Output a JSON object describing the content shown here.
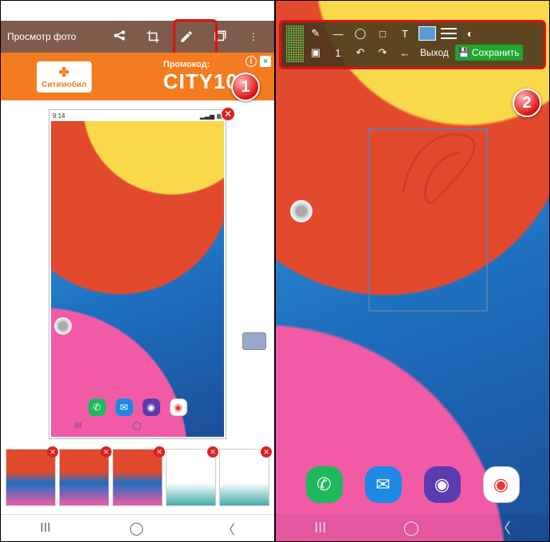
{
  "panel1": {
    "title": "Просмотр фото",
    "ad": {
      "brand": "Ситимобил",
      "promo_label": "Промокод:",
      "code": "CITY10"
    },
    "statusbar_time": "9:14",
    "nav": {
      "recents": "III",
      "home": "◯",
      "back": "〈"
    },
    "step_badge": "1"
  },
  "panel2": {
    "toolbar": {
      "row1_icons": [
        "pencil",
        "line",
        "circle",
        "square",
        "text",
        "color",
        "lines",
        "eyedropper"
      ],
      "row2_icons": [
        "crop",
        "undo",
        "redo",
        "back"
      ],
      "exit_label": "Выход",
      "save_label": "Сохранить"
    },
    "nav": {
      "recents": "III",
      "home": "◯",
      "back": "〈"
    },
    "step_badge": "2"
  },
  "icons": {
    "share": "⤴",
    "crop": "⟀",
    "pencil": "✎",
    "stack": "▣",
    "more": "⋮",
    "phone": "✆",
    "message": "✉",
    "web": "◉",
    "camera": "◉",
    "undo": "↶",
    "redo": "↷",
    "back_arrow": "←",
    "text": "T",
    "circle": "◯",
    "square": "□",
    "line": "—",
    "crop2": "▣",
    "one": "1",
    "eyedropper": "◐"
  }
}
